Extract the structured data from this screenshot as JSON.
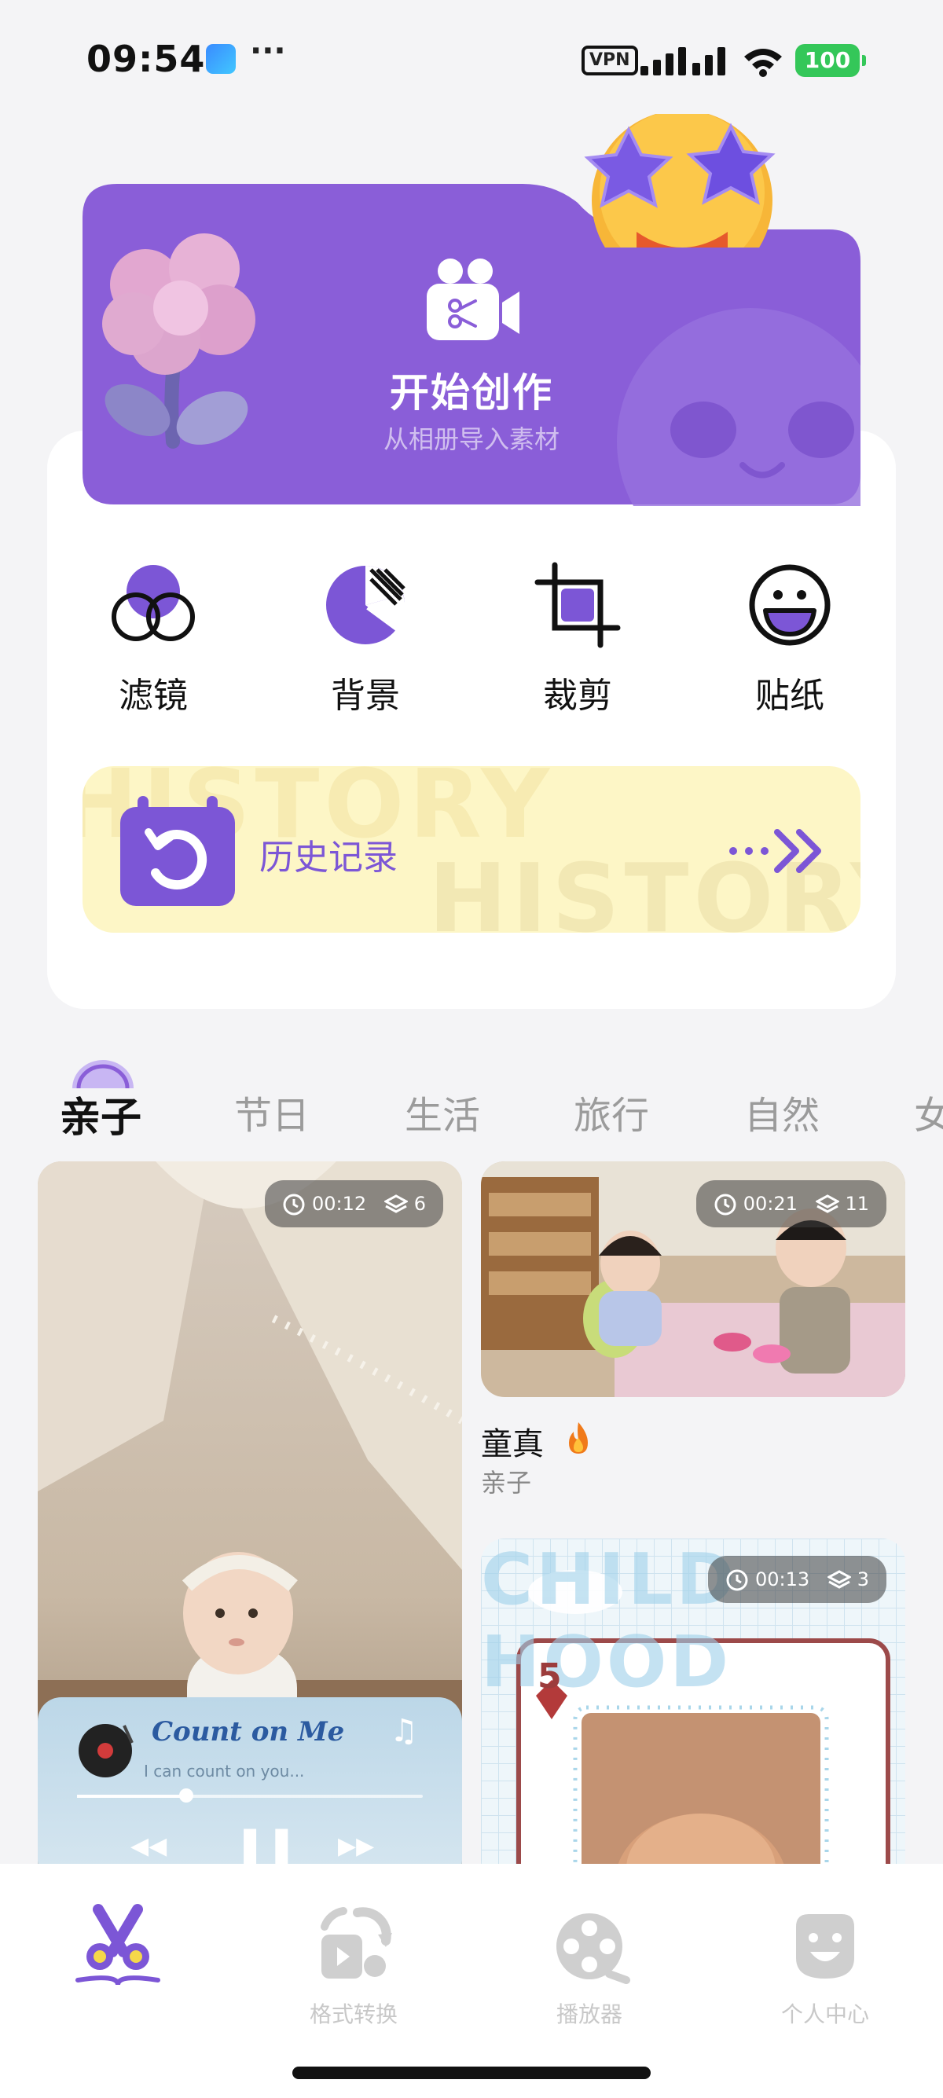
{
  "status_bar": {
    "time": "09:54",
    "dots": "···",
    "vpn": "VPN",
    "battery": "100"
  },
  "banner": {
    "title": "开始创作",
    "subtitle": "从相册导入素材"
  },
  "tools": [
    {
      "label": "滤镜",
      "icon": "filter-icon"
    },
    {
      "label": "背景",
      "icon": "background-icon"
    },
    {
      "label": "裁剪",
      "icon": "crop-icon"
    },
    {
      "label": "贴纸",
      "icon": "sticker-icon"
    }
  ],
  "history": {
    "label": "历史记录",
    "watermark": "HISTORY"
  },
  "categories": [
    "亲子",
    "节日",
    "生活",
    "旅行",
    "自然",
    "女"
  ],
  "feed": {
    "left_card": {
      "duration": "00:12",
      "layers": "6",
      "music_title": "Count on Me",
      "music_subtitle": "I can count on you..."
    },
    "right_card_1": {
      "duration": "00:21",
      "layers": "11",
      "title": "童真",
      "category": "亲子"
    },
    "right_card_2": {
      "duration": "00:13",
      "layers": "3",
      "bg_text": "CHILD HOOD",
      "card_number": "5"
    }
  },
  "nav": [
    {
      "label": "",
      "icon": "scissors-icon",
      "active": true
    },
    {
      "label": "格式转换",
      "icon": "convert-icon",
      "active": false
    },
    {
      "label": "播放器",
      "icon": "player-icon",
      "active": false
    },
    {
      "label": "个人中心",
      "icon": "profile-icon",
      "active": false
    }
  ],
  "colors": {
    "accent": "#7c56d6",
    "banner": "#8a5ed8",
    "history_bg": "#fdf6c6"
  }
}
